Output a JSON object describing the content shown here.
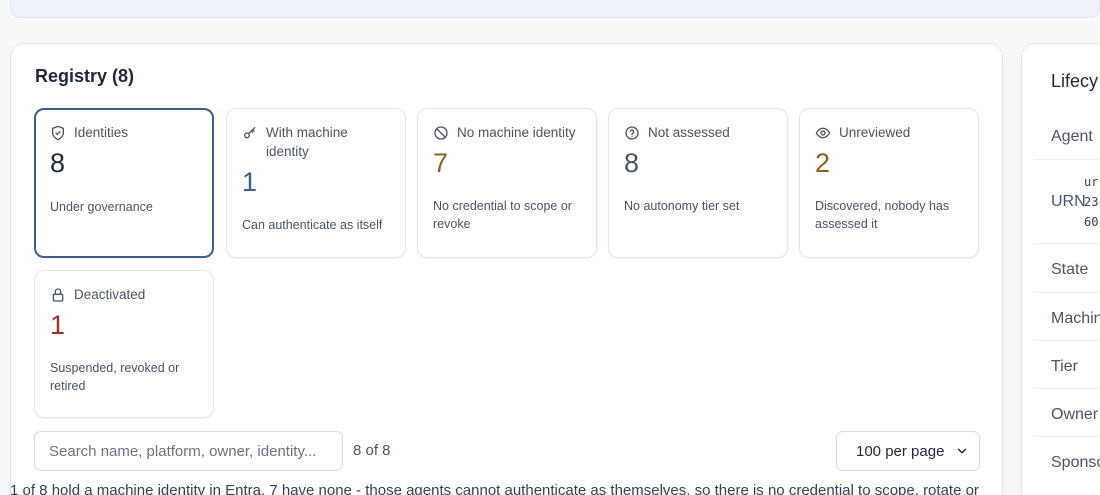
{
  "registry": {
    "title": "Registry (8)",
    "cards": [
      {
        "label": "Identities",
        "value": "8",
        "sub": "Under governance",
        "icon": "shield-icon",
        "color": "#1f2937"
      },
      {
        "label": "With machine identity",
        "value": "1",
        "sub": "Can authenticate as itself",
        "icon": "key-icon",
        "color": "#3d5f86"
      },
      {
        "label": "No machine identity",
        "value": "7",
        "sub": "No credential to scope or revoke",
        "icon": "ban-icon",
        "color": "#8a6228"
      },
      {
        "label": "Not assessed",
        "value": "8",
        "sub": "No autonomy tier set",
        "icon": "question-circle-icon",
        "color": "#4b5563"
      },
      {
        "label": "Unreviewed",
        "value": "2",
        "sub": "Discovered, nobody has assessed it",
        "icon": "eye-icon",
        "color": "#8a6228"
      },
      {
        "label": "Deactivated",
        "value": "1",
        "sub": "Suspended, revoked or retired",
        "icon": "lock-icon",
        "color": "#a3302b"
      }
    ]
  },
  "search": {
    "placeholder": "Search name, platform, owner, identity..."
  },
  "results": {
    "count": "8 of 8"
  },
  "pagination": {
    "per_page": "100 per page"
  },
  "footer": {
    "note": "1 of 8 hold a machine identity in Entra. 7 have none - those agents cannot authenticate as themselves, so there is no credential to scope, rotate or"
  },
  "lifecycle": {
    "title": "Lifecy",
    "rows": [
      "Agent",
      "URN",
      "State",
      "Machin",
      "Tier",
      "Owner",
      "Sponso"
    ],
    "urn_parts": {
      "top": "ur",
      "mid": "23",
      "bottom": "60"
    }
  }
}
